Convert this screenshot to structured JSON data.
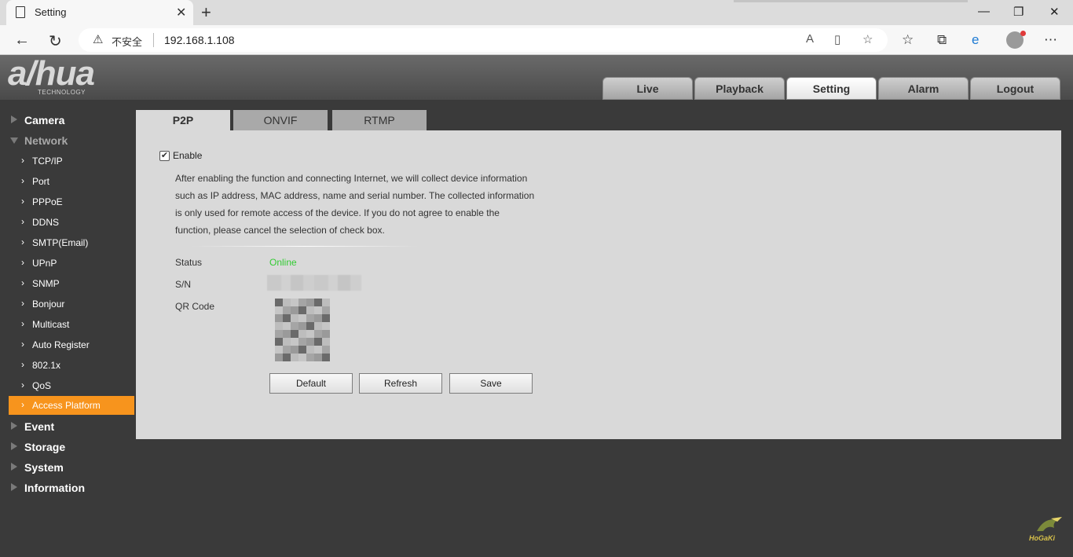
{
  "browser": {
    "tab_title": "Setting",
    "tab_close": "✕",
    "new_tab": "+",
    "security_text": "不安全",
    "url": "192.168.1.108",
    "window_controls": {
      "minimize": "—",
      "restore": "❐",
      "close": "✕"
    }
  },
  "app": {
    "logo_text": "a/hua",
    "logo_sub": "TECHNOLOGY",
    "top_nav": [
      {
        "label": "Live",
        "active": false
      },
      {
        "label": "Playback",
        "active": false
      },
      {
        "label": "Setting",
        "active": true
      },
      {
        "label": "Alarm",
        "active": false
      },
      {
        "label": "Logout",
        "active": false
      }
    ]
  },
  "sidebar": {
    "camera": "Camera",
    "network": "Network",
    "network_items": [
      "TCP/IP",
      "Port",
      "PPPoE",
      "DDNS",
      "SMTP(Email)",
      "UPnP",
      "SNMP",
      "Bonjour",
      "Multicast",
      "Auto Register",
      "802.1x",
      "QoS",
      "Access Platform"
    ],
    "active_item": "Access Platform",
    "event": "Event",
    "storage": "Storage",
    "system": "System",
    "information": "Information"
  },
  "content": {
    "tabs": [
      {
        "label": "P2P",
        "active": true
      },
      {
        "label": "ONVIF",
        "active": false
      },
      {
        "label": "RTMP",
        "active": false
      }
    ],
    "enable_label": "Enable",
    "enable_checked": true,
    "description": "After enabling the function and connecting Internet, we will collect device information such as IP address, MAC address, name and serial number. The collected information is only used for remote access of the device. If you do not agree to enable the function, please cancel the selection of check box.",
    "status_label": "Status",
    "status_value": "Online",
    "sn_label": "S/N",
    "qr_label": "QR Code",
    "buttons": {
      "default": "Default",
      "refresh": "Refresh",
      "save": "Save"
    }
  },
  "watermark_text": "HoGaKi",
  "colors": {
    "accent_orange": "#f7941d",
    "status_green": "#33cc33",
    "panel_bg": "#d9d9d9",
    "page_bg": "#3a3a3a"
  }
}
